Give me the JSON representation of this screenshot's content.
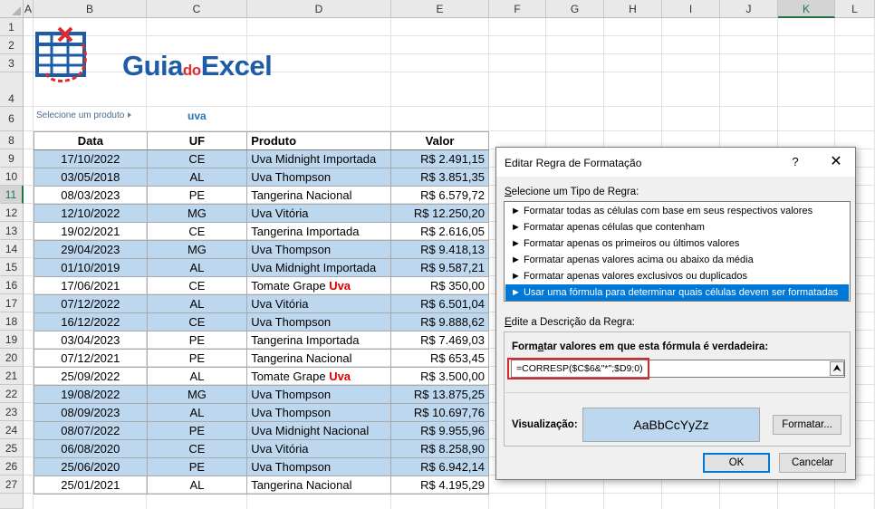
{
  "sheet": {
    "columns": [
      "A",
      "B",
      "C",
      "D",
      "E",
      "F",
      "G",
      "H",
      "I",
      "J",
      "K",
      "L"
    ],
    "rows": [
      "1",
      "2",
      "3",
      "4",
      "6",
      "8",
      "9",
      "10",
      "11",
      "12",
      "13",
      "14",
      "15",
      "16",
      "17",
      "18",
      "19",
      "20",
      "21",
      "22",
      "23",
      "24",
      "25",
      "26",
      "27"
    ],
    "selected_column": "K",
    "selected_row": "11"
  },
  "logo": {
    "part1": "Guia",
    "part2": "do",
    "part3": "Excel"
  },
  "selector": {
    "label": "Selecione um produto",
    "value": "uva"
  },
  "table": {
    "headers": [
      "Data",
      "UF",
      "Produto",
      "Valor"
    ],
    "rows": [
      {
        "data": "17/10/2022",
        "uf": "CE",
        "produto": "Uva Midnight Importada",
        "valor": "R$ 2.491,15",
        "highlight": true
      },
      {
        "data": "03/05/2018",
        "uf": "AL",
        "produto": "Uva Thompson",
        "valor": "R$ 3.851,35",
        "highlight": true
      },
      {
        "data": "08/03/2023",
        "uf": "PE",
        "produto": "Tangerina Nacional",
        "valor": "R$ 6.579,72",
        "highlight": false
      },
      {
        "data": "12/10/2022",
        "uf": "MG",
        "produto": "Uva Vitória",
        "valor": "R$ 12.250,20",
        "highlight": true
      },
      {
        "data": "19/02/2021",
        "uf": "CE",
        "produto": "Tangerina Importada",
        "valor": "R$ 2.616,05",
        "highlight": false
      },
      {
        "data": "29/04/2023",
        "uf": "MG",
        "produto": "Uva Thompson",
        "valor": "R$ 9.418,13",
        "highlight": true
      },
      {
        "data": "01/10/2019",
        "uf": "AL",
        "produto": "Uva Midnight Importada",
        "valor": "R$ 9.587,21",
        "highlight": true
      },
      {
        "data": "17/06/2021",
        "uf": "CE",
        "produto": "Tomate Grape ",
        "produto_red": "Uva",
        "valor": "R$ 350,00",
        "highlight": false
      },
      {
        "data": "07/12/2022",
        "uf": "AL",
        "produto": "Uva Vitória",
        "valor": "R$ 6.501,04",
        "highlight": true
      },
      {
        "data": "16/12/2022",
        "uf": "CE",
        "produto": "Uva Thompson",
        "valor": "R$ 9.888,62",
        "highlight": true
      },
      {
        "data": "03/04/2023",
        "uf": "PE",
        "produto": "Tangerina Importada",
        "valor": "R$ 7.469,03",
        "highlight": false
      },
      {
        "data": "07/12/2021",
        "uf": "PE",
        "produto": "Tangerina Nacional",
        "valor": "R$ 653,45",
        "highlight": false
      },
      {
        "data": "25/09/2022",
        "uf": "AL",
        "produto": "Tomate Grape ",
        "produto_red": "Uva",
        "valor": "R$ 3.500,00",
        "highlight": false
      },
      {
        "data": "19/08/2022",
        "uf": "MG",
        "produto": "Uva Thompson",
        "valor": "R$ 13.875,25",
        "highlight": true
      },
      {
        "data": "08/09/2023",
        "uf": "AL",
        "produto": "Uva Thompson",
        "valor": "R$ 10.697,76",
        "highlight": true
      },
      {
        "data": "08/07/2022",
        "uf": "PE",
        "produto": "Uva Midnight Nacional",
        "valor": "R$ 9.955,96",
        "highlight": true
      },
      {
        "data": "06/08/2020",
        "uf": "CE",
        "produto": "Uva Vitória",
        "valor": "R$ 8.258,90",
        "highlight": true
      },
      {
        "data": "25/06/2020",
        "uf": "PE",
        "produto": "Uva Thompson",
        "valor": "R$ 6.942,14",
        "highlight": true
      },
      {
        "data": "25/01/2021",
        "uf": "AL",
        "produto": "Tangerina Nacional",
        "valor": "R$ 4.195,29",
        "highlight": false
      }
    ]
  },
  "dialog": {
    "title": "Editar Regra de Formatação",
    "help": "?",
    "close": "✕",
    "rule_type_label_pre": "",
    "rule_type_label_u": "S",
    "rule_type_label_post": "elecione um Tipo de Regra:",
    "rule_types": [
      "► Formatar todas as células com base em seus respectivos valores",
      "► Formatar apenas células que contenham",
      "► Formatar apenas os primeiros ou últimos valores",
      "► Formatar apenas valores acima ou abaixo da média",
      "► Formatar apenas valores exclusivos ou duplicados",
      "► Usar uma fórmula para determinar quais células devem ser formatadas"
    ],
    "selected_rule": 5,
    "desc_label_pre": "",
    "desc_label_u": "E",
    "desc_label_post": "dite a Descrição da Regra:",
    "formula_label_pre": "Form",
    "formula_label_u": "a",
    "formula_label_post": "tar valores em que esta fórmula é verdadeira:",
    "formula": "=CORRESP($C$6&\"*\";$D9;0)",
    "collapse_icon": "⮝",
    "preview_label": "Visualização:",
    "preview_text": "AaBbCcYyZz",
    "format_button": "Formatar...",
    "ok_button": "OK",
    "cancel_button": "Cancelar",
    "colors": {
      "selection": "#0078d7",
      "preview_fill": "#bdd7ee",
      "highlight_border": "#d8262d"
    }
  }
}
